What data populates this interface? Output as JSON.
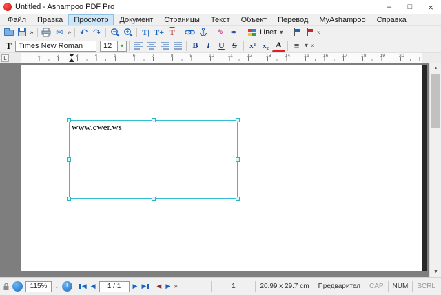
{
  "window": {
    "title": "Untitled - Ashampoo PDF Pro",
    "minimize": "–",
    "maximize": "□",
    "close": "×"
  },
  "menu": {
    "items": [
      "Файл",
      "Правка",
      "Просмотр",
      "Документ",
      "Страницы",
      "Текст",
      "Объект",
      "Перевод",
      "MyAshampoo",
      "Справка"
    ],
    "active": "Просмотр"
  },
  "toolbar_main": {
    "overflow": "»",
    "undo": "↶",
    "redo": "↷",
    "mail": "✉",
    "text_edit": "T|",
    "text_add": "T+",
    "text_frame": "T",
    "pen": "✎",
    "pen2": "✒",
    "color_label": "Цвет",
    "dropdown": "▾"
  },
  "toolbar_format": {
    "t_icon": "T",
    "font_name": "Times New Roman",
    "font_size": "12",
    "dropdown": "▾",
    "bold": "B",
    "italic": "I",
    "underline": "U",
    "strike": "S",
    "superscript": "x²",
    "subscript": "x₂",
    "font_color": "A",
    "list": "≡",
    "overflow": "»"
  },
  "ruler": {
    "numbers": [
      "1",
      "2",
      "3",
      "4",
      "5",
      "6",
      "7",
      "8",
      "9",
      "10",
      "11",
      "12",
      "13",
      "14",
      "15",
      "16",
      "17",
      "18",
      "19",
      "20"
    ]
  },
  "document": {
    "textbox_text": "www.cwer.ws"
  },
  "scrollbar": {
    "up": "▲",
    "down": "▼"
  },
  "status": {
    "zoom": "115%",
    "zoom_minus": "−",
    "zoom_plus": "+",
    "nav_prev": "◀",
    "nav_next": "▶",
    "page_nav": "1 / 1",
    "back": "◀",
    "forward": "▶",
    "overflow": "»",
    "page_number": "1",
    "page_size": "20.99 x 29.7 cm",
    "preview": "Предварител",
    "cap": "CAP",
    "num": "NUM",
    "scrl": "SCRL"
  },
  "colors": {
    "accent_blue": "#1565c0",
    "selection_cyan": "#35bccd",
    "doc_background": "#7e7e7e"
  }
}
